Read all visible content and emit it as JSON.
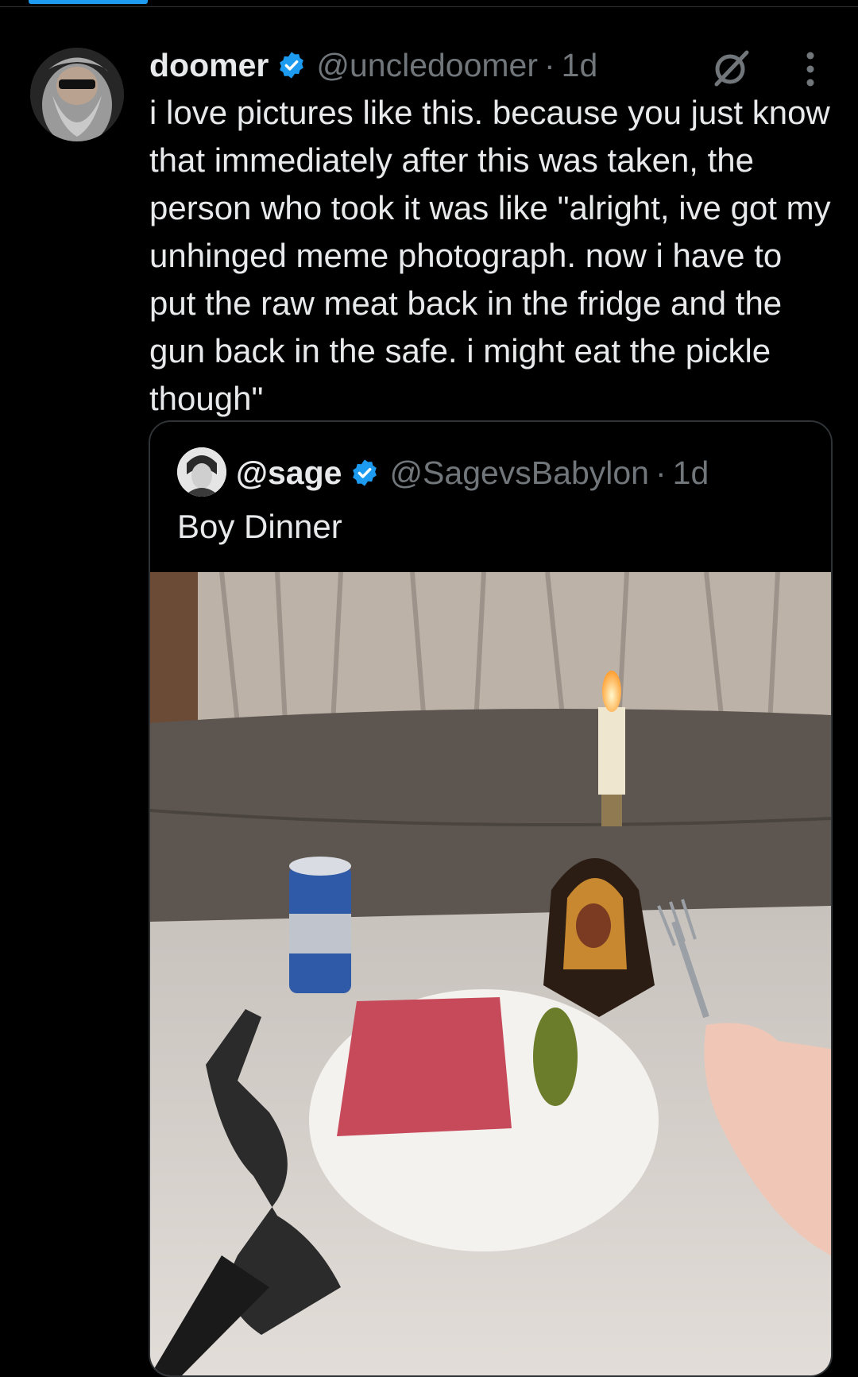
{
  "post": {
    "display_name": "doomer",
    "handle": "@uncledoomer",
    "separator": "·",
    "time": "1d",
    "text": "i love pictures like this. because you just know that immediately after this was taken, the person who took it was like \"alright, ive got my unhinged meme photograph. now i have to put the raw meat back in the fridge and the gun back in the safe. i might eat the pickle though\"",
    "avatar_icon": "avatar",
    "verified_icon": "verified-badge-icon",
    "grok_icon": "grok-icon",
    "more_icon": "more-options-icon"
  },
  "quote": {
    "display_name": "@sage",
    "handle": "@SagevsBabylon",
    "separator": "·",
    "time": "1d",
    "text": "Boy Dinner",
    "verified_icon": "verified-badge-icon",
    "media_icon": "photo"
  },
  "colors": {
    "background": "#000000",
    "text": "#e7e9ea",
    "secondary_text": "#71767b",
    "accent": "#1d9bf0",
    "border": "#2f3336"
  }
}
